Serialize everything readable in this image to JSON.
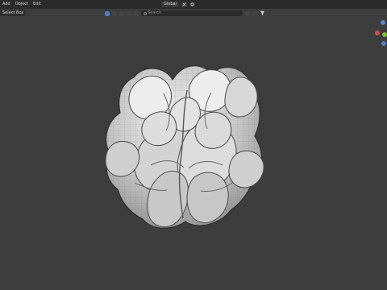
{
  "menu": [
    "Add",
    "Object",
    "Edit"
  ],
  "header": {
    "mode": "Global",
    "select_box": "Select Box",
    "search_placeholder": "Search"
  },
  "icons": {
    "view_icon": "camera",
    "gizmo_x": "x-axis",
    "gizmo_y": "y-axis",
    "gizmo_z": "z-axis",
    "filter_icon": "funnel"
  }
}
